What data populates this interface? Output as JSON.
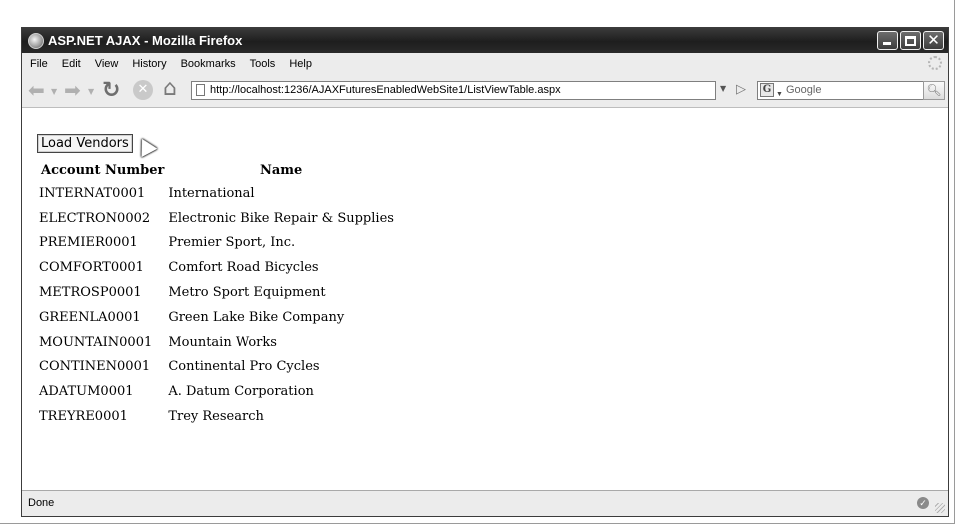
{
  "window": {
    "title": "ASP.NET AJAX - Mozilla Firefox"
  },
  "menu": [
    "File",
    "Edit",
    "View",
    "History",
    "Bookmarks",
    "Tools",
    "Help"
  ],
  "navigation": {
    "url": "http://localhost:1236/AJAXFuturesEnabledWebSite1/ListViewTable.aspx",
    "search_placeholder": "Google"
  },
  "page": {
    "load_button_label": "Load Vendors",
    "columns": [
      "Account Number",
      "Name"
    ],
    "rows": [
      {
        "account": "INTERNAT0001",
        "name": "International"
      },
      {
        "account": "ELECTRON0002",
        "name": "Electronic Bike Repair & Supplies"
      },
      {
        "account": "PREMIER0001",
        "name": "Premier Sport, Inc."
      },
      {
        "account": "COMFORT0001",
        "name": "Comfort Road Bicycles"
      },
      {
        "account": "METROSP0001",
        "name": "Metro Sport Equipment"
      },
      {
        "account": "GREENLA0001",
        "name": "Green Lake Bike Company"
      },
      {
        "account": "MOUNTAIN0001",
        "name": "Mountain Works"
      },
      {
        "account": "CONTINEN0001",
        "name": "Continental Pro Cycles"
      },
      {
        "account": "ADATUM0001",
        "name": "A. Datum Corporation"
      },
      {
        "account": "TREYRE0001",
        "name": "Trey Research"
      }
    ]
  },
  "status": {
    "text": "Done"
  },
  "icons": {
    "back": "back-arrow-icon",
    "forward": "forward-arrow-icon",
    "reload": "reload-icon",
    "stop": "stop-icon",
    "home": "home-icon",
    "go": "go-icon",
    "search": "magnifier-icon"
  }
}
